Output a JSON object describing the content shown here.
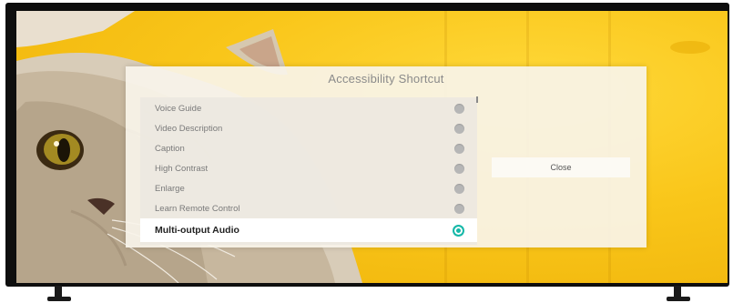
{
  "dialog": {
    "title": "Accessibility Shortcut",
    "items": [
      {
        "label": "Voice Guide",
        "selected": false
      },
      {
        "label": "Video Description",
        "selected": false
      },
      {
        "label": "Caption",
        "selected": false
      },
      {
        "label": "High Contrast",
        "selected": false
      },
      {
        "label": "Enlarge",
        "selected": false
      },
      {
        "label": "Learn Remote Control",
        "selected": false
      },
      {
        "label": "Multi-output Audio",
        "selected": true
      }
    ],
    "close_label": "Close"
  },
  "colors": {
    "background_yellow": "#f9c61a",
    "selected_radio": "#16b8a8",
    "bezel": "#0e0e0e"
  }
}
